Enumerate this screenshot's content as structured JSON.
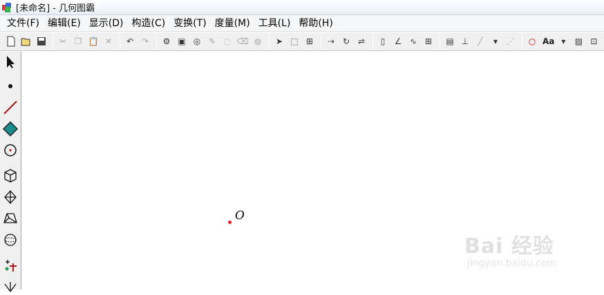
{
  "window": {
    "title": "[未命名] - 几何图霸"
  },
  "menu": [
    {
      "label": "文件(F)"
    },
    {
      "label": "编辑(E)"
    },
    {
      "label": "显示(D)"
    },
    {
      "label": "构造(C)"
    },
    {
      "label": "变换(T)"
    },
    {
      "label": "度量(M)"
    },
    {
      "label": "工具(L)"
    },
    {
      "label": "帮助(H)"
    }
  ],
  "toolbar": {
    "font_label": "Aa"
  },
  "canvas": {
    "point_label": "O",
    "point_color": "#e02020"
  },
  "watermark": {
    "brand": "Bai 经验",
    "url": "jingyan.baidu.com"
  },
  "icons": [
    "new-file-icon",
    "open-file-icon",
    "save-icon",
    "cut-icon",
    "copy-icon",
    "paste-icon",
    "delete-icon",
    "undo-icon",
    "redo-icon",
    "arrow-select-icon",
    "point-tool-icon",
    "segment-tool-icon",
    "polygon-tool-icon",
    "circle-tool-icon",
    "cube-tool-icon",
    "octahedron-tool-icon",
    "frustum-tool-icon",
    "sphere-tool-icon",
    "custom-tool-icon"
  ]
}
